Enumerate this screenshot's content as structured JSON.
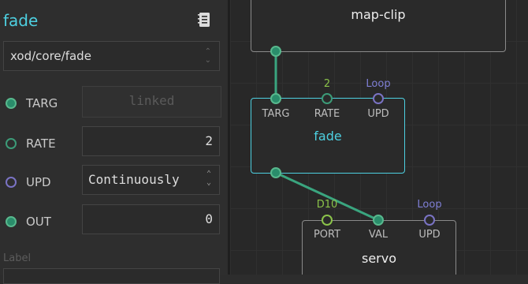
{
  "inspector": {
    "node_title": "fade",
    "node_type": "xod/core/fade",
    "pins": [
      {
        "name": "TARG",
        "value": "linked"
      },
      {
        "name": "RATE",
        "value": "2"
      },
      {
        "name": "UPD",
        "value": "Continuously"
      },
      {
        "name": "OUT",
        "value": "0"
      }
    ],
    "label_caption": "Label"
  },
  "canvas": {
    "map_clip": {
      "title": "map-clip"
    },
    "fade": {
      "title": "fade",
      "pins": [
        {
          "label": "TARG",
          "value": ""
        },
        {
          "label": "RATE",
          "value": "2"
        },
        {
          "label": "UPD",
          "value": "Loop"
        }
      ]
    },
    "servo": {
      "title": "servo",
      "pins": [
        {
          "label": "PORT",
          "value": "D10"
        },
        {
          "label": "VAL",
          "value": ""
        },
        {
          "label": "UPD",
          "value": "Loop"
        }
      ]
    }
  },
  "colors": {
    "accent": "#4dd0e1",
    "pin_green": "#2a8d6b",
    "pin_purple": "#7a73c4",
    "value_green": "#8bc34a",
    "value_purple": "#7f7fd5",
    "link": "#3aa57f"
  },
  "icons": {
    "help": "help-book-icon"
  }
}
